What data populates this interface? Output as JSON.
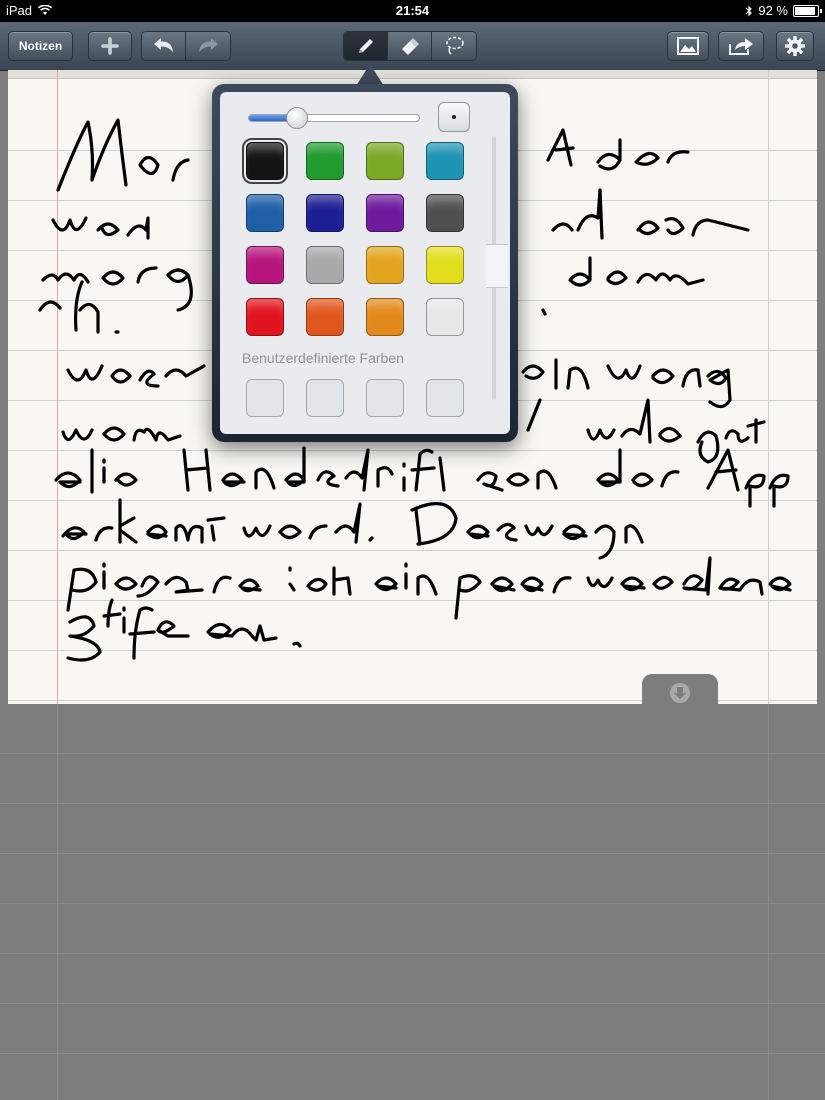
{
  "status_bar": {
    "device": "iPad",
    "time": "21:54",
    "battery_percent": "92 %",
    "battery_level": 0.92
  },
  "toolbar": {
    "notes_button_label": "Notizen",
    "icons": [
      "plus-icon",
      "undo-icon",
      "redo-icon",
      "pen-icon",
      "eraser-icon",
      "lasso-icon",
      "image-icon",
      "share-icon",
      "gear-icon"
    ],
    "active_tool": "pen"
  },
  "color_picker": {
    "pen_size_fraction": 0.28,
    "colors": [
      [
        "#141414",
        "#1f9a2b",
        "#7aa924",
        "#1e93b4"
      ],
      [
        "#1f5fa8",
        "#1c1f93",
        "#6d1a9c",
        "#4f4f4f"
      ],
      [
        "#b5157c",
        "#a9a9a9",
        "#e3a51d",
        "#e2de1e"
      ],
      [
        "#e0141e",
        "#e0571d",
        "#e38a1c",
        "#e8e8e8"
      ]
    ],
    "selected_color": "#141414",
    "custom_colors_label": "Benutzerdefinierte Farben",
    "custom_slots": 4
  },
  "colors": {
    "toolbar": "#4a5564",
    "paper": "#f8f7f1",
    "ink": "#000000",
    "overlay": "#7d7d7d"
  }
}
